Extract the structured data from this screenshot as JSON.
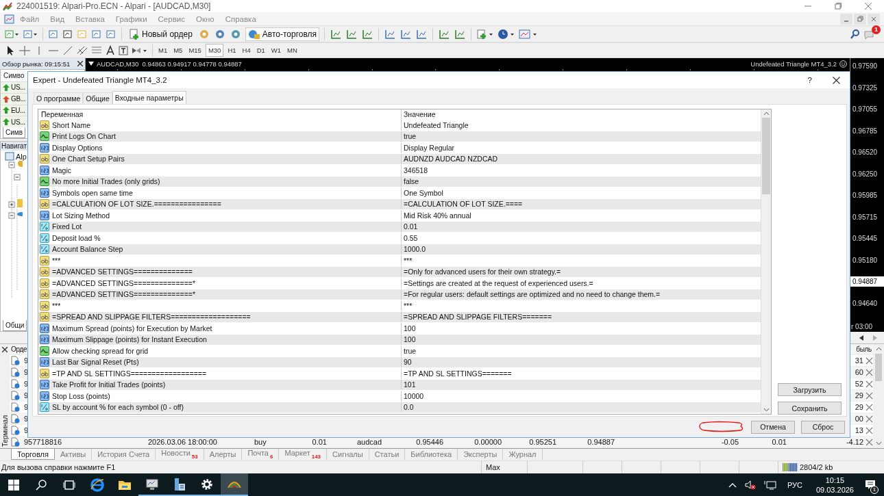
{
  "window": {
    "title": "224001519: Alpari-Pro.ECN - Alpari - [AUDCAD,M30]"
  },
  "menu": [
    "Файл",
    "Вид",
    "Вставка",
    "Графики",
    "Сервис",
    "Окно",
    "Справка"
  ],
  "toolbar": {
    "new_order": "Новый ордер",
    "auto_trading": "Авто-торговля",
    "notifications": "1"
  },
  "timeframes": [
    {
      "label": "M1",
      "selected": false
    },
    {
      "label": "M5",
      "selected": false
    },
    {
      "label": "M15",
      "selected": false
    },
    {
      "label": "M30",
      "selected": true
    },
    {
      "label": "H1",
      "selected": false
    },
    {
      "label": "H4",
      "selected": false
    },
    {
      "label": "D1",
      "selected": false
    },
    {
      "label": "W1",
      "selected": false
    },
    {
      "label": "MN",
      "selected": false
    }
  ],
  "market_watch": {
    "title": "Обзор рынка: 09:15:51",
    "column": "Симво",
    "tab": "Симв",
    "symbols": [
      {
        "symbol": "US...",
        "kind": "up"
      },
      {
        "symbol": "GB...",
        "kind": "down"
      },
      {
        "symbol": "EU...",
        "kind": "up"
      },
      {
        "symbol": "US...",
        "kind": "up"
      }
    ]
  },
  "navigator": {
    "title": "Навигат",
    "root": "Alp",
    "tab": "Общи"
  },
  "chart": {
    "header": "AUDCAD,M30  0.94863 0.94917 0.94778 0.94887",
    "expert": "Undefeated Triangle MT4_3.2",
    "time_label": "r 03:00",
    "prices": [
      {
        "value": "0.97590",
        "kind": "scale"
      },
      {
        "value": "0.97325",
        "kind": "scale"
      },
      {
        "value": "0.97055",
        "kind": "scale"
      },
      {
        "value": "0.96785",
        "kind": "scale"
      },
      {
        "value": "0.96520",
        "kind": "scale"
      },
      {
        "value": "0.96250",
        "kind": "scale"
      },
      {
        "value": "0.95985",
        "kind": "scale"
      },
      {
        "value": "0.95715",
        "kind": "scale"
      },
      {
        "value": "0.95445",
        "kind": "scale"
      },
      {
        "value": "0.95180",
        "kind": "scale"
      },
      {
        "value": "0.94887",
        "kind": "current"
      },
      {
        "value": "0.94640",
        "kind": "scale"
      }
    ]
  },
  "dialog": {
    "title": "Expert - Undefeated Triangle MT4_3.2",
    "help": "?",
    "tabs": [
      {
        "label": "О программе",
        "selected": false
      },
      {
        "label": "Общие",
        "selected": false
      },
      {
        "label": "Входные параметры",
        "selected": true
      }
    ],
    "columns": [
      "Переменная",
      "Значение"
    ],
    "parameters": [
      {
        "kind": "string",
        "name": "Short Name",
        "value": "Undefeated Triangle"
      },
      {
        "kind": "bool",
        "name": "Print Logs On Chart",
        "value": "true"
      },
      {
        "kind": "int",
        "name": "Display Options",
        "value": "Display Regular"
      },
      {
        "kind": "string",
        "name": "One Chart Setup Pairs",
        "value": "AUDNZD AUDCAD NZDCAD"
      },
      {
        "kind": "int",
        "name": "Magic",
        "value": "346518"
      },
      {
        "kind": "bool",
        "name": "No more Initial Trades (only grids)",
        "value": "false"
      },
      {
        "kind": "int",
        "name": "Symbols open same time",
        "value": "One Symbol"
      },
      {
        "kind": "string",
        "name": "=CALCULATION OF LOT SIZE.================",
        "value": "=CALCULATION OF LOT SIZE.===="
      },
      {
        "kind": "int",
        "name": "Lot Sizing Method",
        "value": "Mid Risk 40% annual"
      },
      {
        "kind": "double",
        "name": "Fixed Lot",
        "value": "0.01"
      },
      {
        "kind": "double",
        "name": "Deposit load %",
        "value": "0.55"
      },
      {
        "kind": "double",
        "name": "Account Balance Step",
        "value": "1000.0"
      },
      {
        "kind": "string",
        "name": "***",
        "value": "***"
      },
      {
        "kind": "string",
        "name": "=ADVANCED SETTINGS==============",
        "value": "=Only for advanced users for their own strategy.="
      },
      {
        "kind": "string",
        "name": "=ADVANCED SETTINGS==============*",
        "value": "=Settings are created at the request of experienced users.="
      },
      {
        "kind": "string",
        "name": "=ADVANCED SETTINGS==============*",
        "value": "=For regular users: default settings are optimized and no need to change them.="
      },
      {
        "kind": "string",
        "name": "***",
        "value": "***"
      },
      {
        "kind": "string",
        "name": "=SPREAD AND SLIPPAGE FILTERS===================",
        "value": "=SPREAD AND SLIPPAGE FILTERS======="
      },
      {
        "kind": "int",
        "name": "Maximum Spread (points) for Execution by Market",
        "value": "100"
      },
      {
        "kind": "int",
        "name": "Maximum Slippage (points) for Instant Execution",
        "value": "100"
      },
      {
        "kind": "bool",
        "name": "Allow checking spread for grid",
        "value": "true"
      },
      {
        "kind": "int",
        "name": "Last Bar Signal Reset (Pts)",
        "value": "90"
      },
      {
        "kind": "string",
        "name": "=TP AND SL SETTINGS==================",
        "value": "=TP AND SL SETTINGS======="
      },
      {
        "kind": "int",
        "name": "Take Profit for Initial Trades (points)",
        "value": "101"
      },
      {
        "kind": "int",
        "name": "Stop Loss (points)",
        "value": "10000"
      },
      {
        "kind": "double",
        "name": "SL by account % for each symbol (0 - off)",
        "value": "0.0"
      }
    ],
    "load": "Загрузить",
    "save": "Сохранить",
    "cancel": "Отмена",
    "reset": "Сброс"
  },
  "terminal": {
    "label": "Терминал",
    "columns": [
      "Орде",
      "быль"
    ],
    "rows": [
      {
        "order": "9",
        "profit": "31"
      },
      {
        "order": "9",
        "profit": "60"
      },
      {
        "order": "9",
        "profit": "52"
      },
      {
        "order": "9",
        "profit": "29"
      },
      {
        "order": "9",
        "profit": "29"
      },
      {
        "order": "9",
        "profit": "00"
      },
      {
        "order": "9",
        "profit": "13"
      },
      {
        "order": "957718816",
        "time": "2026.03.06 18:00:00",
        "type": "buy",
        "size": "0.01",
        "symbol": "audcad",
        "price": "0.95446",
        "sl": "0.00000",
        "tp": "0.95251",
        "current": "0.94887",
        "commission": "-0.05",
        "swap": "0.01",
        "profit": "-4.12"
      }
    ],
    "tabs": [
      {
        "label": "Торговля",
        "selected": true
      },
      {
        "label": "Активы",
        "selected": false
      },
      {
        "label": "История Счета",
        "selected": false
      },
      {
        "label": "Новости",
        "count": "53",
        "selected": false
      },
      {
        "label": "Алерты",
        "selected": false
      },
      {
        "label": "Почта",
        "count": "6",
        "selected": false
      },
      {
        "label": "Маркет",
        "count": "143",
        "selected": false
      },
      {
        "label": "Сигналы",
        "selected": false
      },
      {
        "label": "Статьи",
        "selected": false
      },
      {
        "label": "Библиотека",
        "selected": false
      },
      {
        "label": "Эксперты",
        "selected": false
      },
      {
        "label": "Журнал",
        "selected": false
      }
    ]
  },
  "status_bar": {
    "help": "Для вызова справки нажмите F1",
    "profile": "Max",
    "traffic": "2804/2 kb"
  },
  "taskbar": {
    "apps": [
      {
        "kind": "browser",
        "running": false,
        "active": false
      },
      {
        "kind": "folder",
        "running": false,
        "active": false
      },
      {
        "kind": "monitor",
        "running": true,
        "active": false
      },
      {
        "kind": "server",
        "running": true,
        "active": false
      },
      {
        "kind": "gear",
        "running": true,
        "active": false
      },
      {
        "kind": "terminal",
        "running": true,
        "active": true
      }
    ],
    "language": "РУС",
    "time": "10:15",
    "date": "09.03.2026",
    "notifications": "1"
  }
}
